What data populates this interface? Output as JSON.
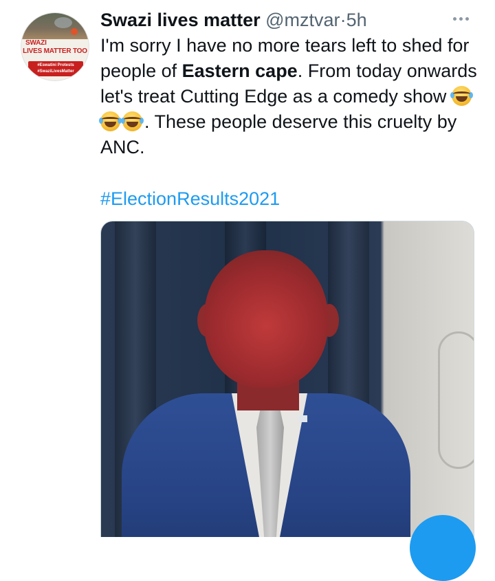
{
  "tweet": {
    "avatar": {
      "line1": "SWAZI",
      "line2": "LIVES MATTER TOO",
      "banner_line1": "#Eswatini Protests",
      "banner_line2": "#SwaziLivesMatter"
    },
    "display_name": "Swazi lives matter",
    "handle": "@mztvar",
    "separator": "·",
    "time": "5h",
    "text_part1": "I'm sorry I have no more tears left to shed for people of ",
    "text_bold": "Eastern cape",
    "text_part2": ". From today onwards let's treat Cutting Edge as a comedy show ",
    "emojis": [
      "tears-of-joy-emoji",
      "tears-of-joy-emoji",
      "tears-of-joy-emoji"
    ],
    "text_part3": ". These people deserve this cruelty  by ANC.",
    "hashtag": "#ElectionResults2021",
    "media": {
      "kind": "video-still",
      "subject": "man-in-blue-suit"
    }
  },
  "colors": {
    "link": "#1d9bf0",
    "secondary_text": "#536471",
    "primary_text": "#0f1419"
  },
  "icons": {
    "more": "more-dots-icon",
    "compose": "compose-fab"
  }
}
